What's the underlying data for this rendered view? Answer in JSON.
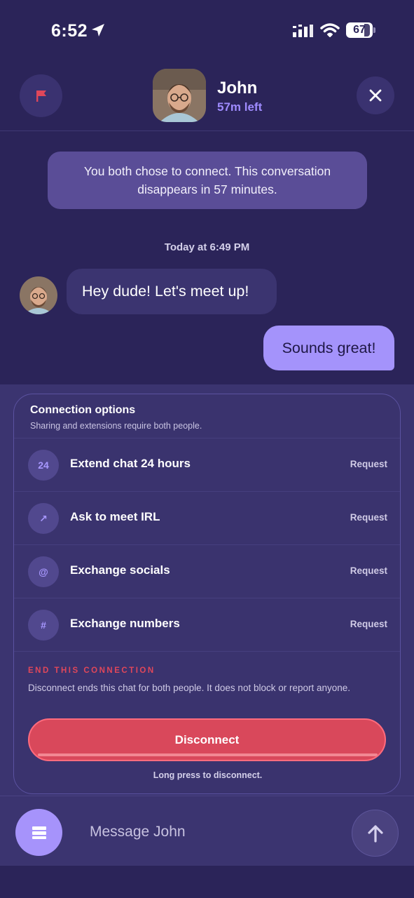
{
  "status_bar": {
    "time": "6:52",
    "battery": "67",
    "icons": [
      "location-arrow-icon",
      "signal-icon",
      "wifi-icon",
      "battery-icon"
    ]
  },
  "header": {
    "contact_name": "John",
    "time_left": "57m left",
    "flag_icon": "flag-icon",
    "close_icon": "close-icon"
  },
  "conversation": {
    "system_note": "You both chose to connect. This conversation disappears in 57 minutes.",
    "timestamp": "Today at 6:49 PM",
    "messages": [
      {
        "from": "John",
        "direction": "incoming",
        "text": "Hey dude! Let's meet up!"
      },
      {
        "from": "me",
        "direction": "outgoing",
        "text": "Sounds great!"
      }
    ]
  },
  "connection_options": {
    "title": "Connection options",
    "subtitle": "Sharing and extensions require both people.",
    "items": [
      {
        "icon": "24",
        "icon_name": "hours-24-icon",
        "label": "Extend chat 24 hours",
        "action": "Request"
      },
      {
        "icon": "↗",
        "icon_name": "arrow-up-right-icon",
        "label": "Ask to meet IRL",
        "action": "Request"
      },
      {
        "icon": "@",
        "icon_name": "at-icon",
        "label": "Exchange socials",
        "action": "Request"
      },
      {
        "icon": "#",
        "icon_name": "hash-icon",
        "label": "Exchange numbers",
        "action": "Request"
      }
    ],
    "end_section": {
      "title": "END THIS CONNECTION",
      "description": "Disconnect ends this chat for both people. It does not block or report anyone.",
      "button_label": "Disconnect",
      "hint": "Long press to disconnect."
    }
  },
  "composer": {
    "placeholder": "Message John",
    "menu_icon": "menu-icon",
    "send_icon": "arrow-up-icon"
  },
  "colors": {
    "background": "#2b2459",
    "accent": "#a693fb",
    "time_left": "#9f8bff",
    "danger": "#d9485b",
    "flag": "#e0475a"
  }
}
